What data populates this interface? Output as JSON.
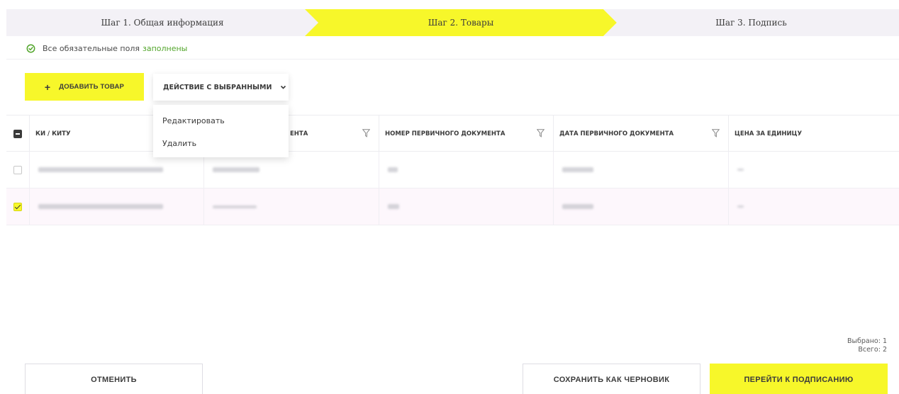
{
  "stepper": {
    "steps": [
      {
        "label": "Шаг 1. Общая информация",
        "state": "done"
      },
      {
        "label": "Шаг 2. Товары",
        "state": "active"
      },
      {
        "label": "Шаг 3. Подпись",
        "state": "pending"
      }
    ]
  },
  "status": {
    "prefix": "Все обязательные поля",
    "highlight": "заполнены",
    "icon": "check-circle-icon"
  },
  "toolbar": {
    "add_label": "ДОБАВИТЬ ТОВАР",
    "action_label": "ДЕЙСТВИЕ С ВЫБРАННЫМИ"
  },
  "action_menu": {
    "items": [
      "Редактировать",
      "Удалить"
    ]
  },
  "table": {
    "columns": [
      {
        "label": "КИ / КИТУ",
        "filter": false
      },
      {
        "label": "ЕНТА",
        "filter": true
      },
      {
        "label": "НОМЕР ПЕРВИЧНОГО ДОКУМЕНТА",
        "filter": true
      },
      {
        "label": "ДАТА ПЕРВИЧНОГО ДОКУМЕНТА",
        "filter": true
      },
      {
        "label": "ЦЕНА ЗА ЕДИНИЦУ",
        "filter": false
      }
    ],
    "rows": [
      {
        "selected": false
      },
      {
        "selected": true
      }
    ]
  },
  "footer": {
    "selected_text": "Выбрано: 1",
    "total_text": "Всего: 2",
    "cancel_label": "ОТМЕНИТЬ",
    "draft_label": "СОХРАНИТЬ КАК ЧЕРНОВИК",
    "sign_label": "ПЕРЕЙТИ К ПОДПИСАНИЮ"
  },
  "colors": {
    "accent": "#f7f72a",
    "success": "#52a52b",
    "step_inactive": "#f3f1f6"
  }
}
